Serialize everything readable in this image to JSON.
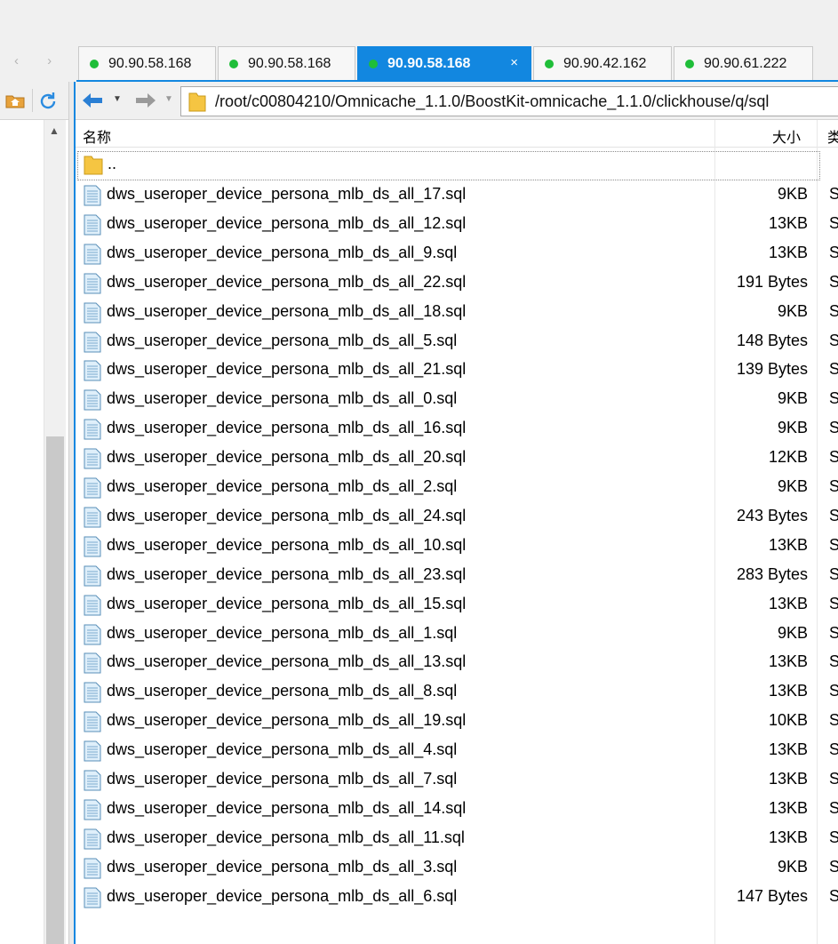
{
  "tabs": [
    {
      "label": "90.90.58.168",
      "active": false
    },
    {
      "label": "90.90.58.168",
      "active": false
    },
    {
      "label": "90.90.58.168",
      "active": true
    },
    {
      "label": "90.90.42.162",
      "active": false
    },
    {
      "label": "90.90.61.222",
      "active": false
    }
  ],
  "tab_close_glyph": "×",
  "nav_arrows": "‹ ›",
  "address": {
    "path": "/root/c00804210/Omnicache_1.1.0/BoostKit-omnicache_1.1.0/clickhouse/q/sql"
  },
  "columns": {
    "name": "名称",
    "size": "大小",
    "type": "类"
  },
  "parent_dir": "..",
  "files": [
    {
      "name": "dws_useroper_device_persona_mlb_ds_all_17.sql",
      "size": "9KB",
      "type": "S("
    },
    {
      "name": "dws_useroper_device_persona_mlb_ds_all_12.sql",
      "size": "13KB",
      "type": "S("
    },
    {
      "name": "dws_useroper_device_persona_mlb_ds_all_9.sql",
      "size": "13KB",
      "type": "S("
    },
    {
      "name": "dws_useroper_device_persona_mlb_ds_all_22.sql",
      "size": "191 Bytes",
      "type": "S("
    },
    {
      "name": "dws_useroper_device_persona_mlb_ds_all_18.sql",
      "size": "9KB",
      "type": "S("
    },
    {
      "name": "dws_useroper_device_persona_mlb_ds_all_5.sql",
      "size": "148 Bytes",
      "type": "S("
    },
    {
      "name": "dws_useroper_device_persona_mlb_ds_all_21.sql",
      "size": "139 Bytes",
      "type": "S("
    },
    {
      "name": "dws_useroper_device_persona_mlb_ds_all_0.sql",
      "size": "9KB",
      "type": "S("
    },
    {
      "name": "dws_useroper_device_persona_mlb_ds_all_16.sql",
      "size": "9KB",
      "type": "S("
    },
    {
      "name": "dws_useroper_device_persona_mlb_ds_all_20.sql",
      "size": "12KB",
      "type": "S("
    },
    {
      "name": "dws_useroper_device_persona_mlb_ds_all_2.sql",
      "size": "9KB",
      "type": "S("
    },
    {
      "name": "dws_useroper_device_persona_mlb_ds_all_24.sql",
      "size": "243 Bytes",
      "type": "S("
    },
    {
      "name": "dws_useroper_device_persona_mlb_ds_all_10.sql",
      "size": "13KB",
      "type": "S("
    },
    {
      "name": "dws_useroper_device_persona_mlb_ds_all_23.sql",
      "size": "283 Bytes",
      "type": "S("
    },
    {
      "name": "dws_useroper_device_persona_mlb_ds_all_15.sql",
      "size": "13KB",
      "type": "S("
    },
    {
      "name": "dws_useroper_device_persona_mlb_ds_all_1.sql",
      "size": "9KB",
      "type": "S("
    },
    {
      "name": "dws_useroper_device_persona_mlb_ds_all_13.sql",
      "size": "13KB",
      "type": "S("
    },
    {
      "name": "dws_useroper_device_persona_mlb_ds_all_8.sql",
      "size": "13KB",
      "type": "S("
    },
    {
      "name": "dws_useroper_device_persona_mlb_ds_all_19.sql",
      "size": "10KB",
      "type": "S("
    },
    {
      "name": "dws_useroper_device_persona_mlb_ds_all_4.sql",
      "size": "13KB",
      "type": "S("
    },
    {
      "name": "dws_useroper_device_persona_mlb_ds_all_7.sql",
      "size": "13KB",
      "type": "S("
    },
    {
      "name": "dws_useroper_device_persona_mlb_ds_all_14.sql",
      "size": "13KB",
      "type": "S("
    },
    {
      "name": "dws_useroper_device_persona_mlb_ds_all_11.sql",
      "size": "13KB",
      "type": "S("
    },
    {
      "name": "dws_useroper_device_persona_mlb_ds_all_3.sql",
      "size": "9KB",
      "type": "S("
    },
    {
      "name": "dws_useroper_device_persona_mlb_ds_all_6.sql",
      "size": "147 Bytes",
      "type": "S("
    }
  ],
  "icons": {
    "home": "home-folder-icon",
    "refresh": "refresh-icon",
    "back": "back-arrow-icon",
    "forward": "forward-arrow-icon",
    "folder": "folder-icon",
    "file": "sql-file-icon"
  },
  "colors": {
    "accent": "#1287e0",
    "status_dot": "#1fbe39",
    "folder": "#f5c542"
  }
}
